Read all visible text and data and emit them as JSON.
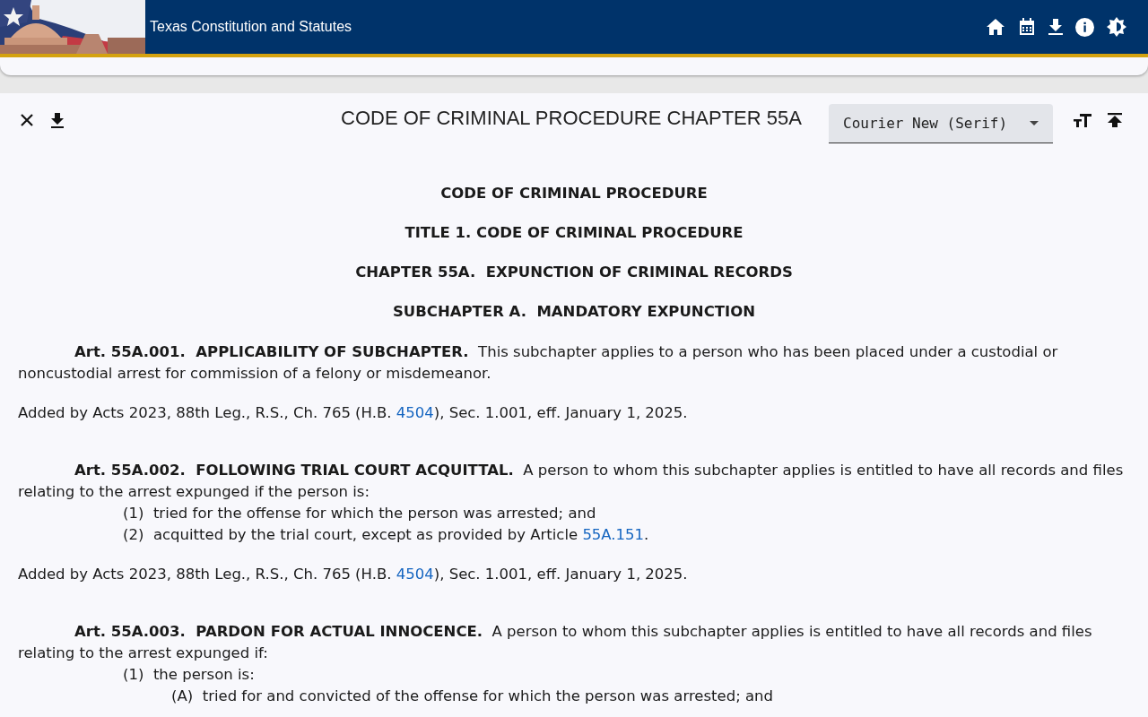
{
  "app_bar": {
    "title": "Texas Constitution and Statutes"
  },
  "toolbar": {
    "title": "CODE OF CRIMINAL PROCEDURE CHAPTER 55A",
    "font_select": {
      "value": "Courier New (Serif)"
    }
  },
  "document": {
    "headings": [
      "CODE OF CRIMINAL PROCEDURE",
      "TITLE 1. CODE OF CRIMINAL PROCEDURE",
      "CHAPTER 55A.  EXPUNCTION OF CRIMINAL RECORDS",
      "SUBCHAPTER A.  MANDATORY EXPUNCTION"
    ],
    "articles": [
      {
        "number": "Art. 55A.001.  APPLICABILITY OF SUBCHAPTER.",
        "text": "This subchapter applies to a person who has been placed under a custodial or noncustodial arrest for commission of a felony or misdemeanor.",
        "history": [
          {
            "text": "Added by Acts 2023, 88th Leg., R.S., Ch. 765 (H.B. "
          },
          {
            "link": "4504"
          },
          {
            "text": "), Sec. 1.001, eff. January 1, 2025."
          }
        ]
      },
      {
        "number": "Art. 55A.002.  FOLLOWING TRIAL COURT ACQUITTAL.",
        "text": "A person to whom this subchapter applies is entitled to have all records and files relating to the arrest expunged if the person is:",
        "items": [
          {
            "label": "(1)",
            "parts": [
              {
                "text": "tried for the offense for which the person was arrested; and"
              }
            ]
          },
          {
            "label": "(2)",
            "parts": [
              {
                "text": "acquitted by the trial court, except as provided by Article "
              },
              {
                "link": "55A.151"
              },
              {
                "text": "."
              }
            ]
          }
        ],
        "history": [
          {
            "text": "Added by Acts 2023, 88th Leg., R.S., Ch. 765 (H.B. "
          },
          {
            "link": "4504"
          },
          {
            "text": "), Sec. 1.001, eff. January 1, 2025."
          }
        ]
      },
      {
        "number": "Art. 55A.003.  PARDON FOR ACTUAL INNOCENCE.",
        "text": "A person to whom this subchapter applies is entitled to have all records and files relating to the arrest expunged if:",
        "items": [
          {
            "label": "(1)",
            "parts": [
              {
                "text": "the person is:"
              }
            ],
            "children": [
              {
                "label": "(A)",
                "parts": [
                  {
                    "text": "tried for and convicted of the offense for which the person was arrested; and"
                  }
                ]
              }
            ]
          }
        ]
      }
    ]
  }
}
